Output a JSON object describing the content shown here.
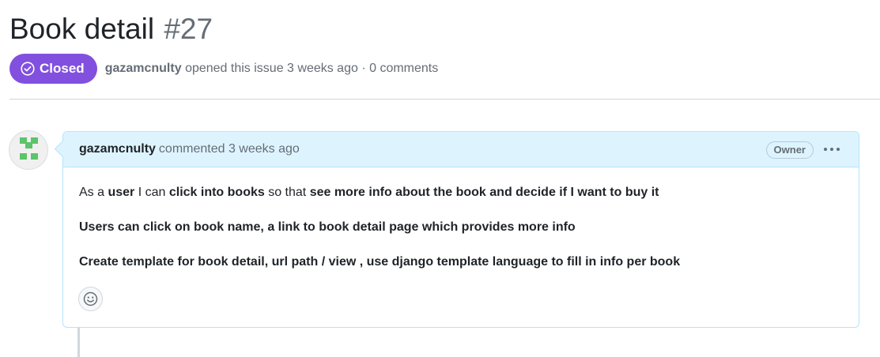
{
  "issue": {
    "title": "Book detail",
    "number": "#27",
    "state": "Closed",
    "author": "gazamcnulty",
    "opened_text": "opened this issue 3 weeks ago · 0 comments"
  },
  "comment": {
    "author": "gazamcnulty",
    "action_text": "commented 3 weeks ago",
    "role_badge": "Owner",
    "body": {
      "line1": {
        "p1": "As a ",
        "p2": "user",
        "p3": " I can ",
        "p4": "click into books",
        "p5": " so that ",
        "p6": "see more info about the book and decide if I want to buy it"
      },
      "line2": "Users can click on book name, a link to book detail page which provides more info",
      "line3": "Create template for book detail, url path / view , use django template language to fill in info per book"
    }
  },
  "icons": {
    "state": "check-circle-icon",
    "menu": "kebab-horizontal-icon",
    "reaction": "smiley-icon"
  },
  "colors": {
    "closed_badge": "#8250df",
    "comment_header_bg": "#ddf4ff",
    "comment_border": "#b6e3ff",
    "avatar_green": "#5cc46a"
  }
}
